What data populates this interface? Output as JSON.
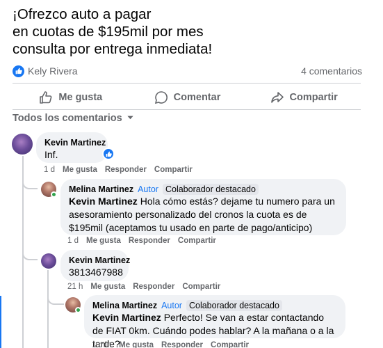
{
  "post": {
    "lines": [
      "¡Ofrezco auto a pagar",
      "en cuotas de $195mil por mes",
      "consulta por entrega inmediata!"
    ],
    "reactor": "Kely Rivera",
    "comment_count": "4 comentarios"
  },
  "actions": {
    "like": "Me gusta",
    "comment": "Comentar",
    "share": "Compartir"
  },
  "filter_label": "Todos los comentarios",
  "comments": [
    {
      "author": "Kevin Martinez",
      "text": "Inf.",
      "time": "1 d",
      "like": "Me gusta",
      "reply": "Responder",
      "share": "Compartir"
    },
    {
      "author": "Melina Martinez",
      "badge_author": "Autor",
      "badge_top": "Colaborador destacado",
      "mention": "Kevin Martinez",
      "text": " Hola cómo estás? dejame tu numero para un asesoramiento personalizado del cronos la cuota es de $195mil (aceptamos tu usado en parte de pago/anticipo)",
      "time": "1 d",
      "like": "Me gusta",
      "reply": "Responder",
      "share": "Compartir"
    },
    {
      "author": "Kevin Martinez",
      "text": "3813467988",
      "time": "21 h",
      "like": "Me gusta",
      "reply": "Responder",
      "share": "Compartir"
    },
    {
      "author": "Melina Martinez",
      "badge_author": "Autor",
      "badge_top": "Colaborador destacado",
      "mention": "Kevin Martinez",
      "text": " Perfecto! Se van a estar contactando de FIAT 0km. Cuándo podes hablar? A la mañana o a la tarde?",
      "time": "1 min",
      "like": "Me gusta",
      "reply": "Responder",
      "share": "Compartir"
    }
  ],
  "colors": {
    "accent": "#1877f2",
    "secondary_text": "#65676b",
    "bubble": "#f0f2f5",
    "online": "#31a24c"
  },
  "icons": [
    "like-icon",
    "comment-icon",
    "share-icon",
    "chevron-down-icon"
  ]
}
